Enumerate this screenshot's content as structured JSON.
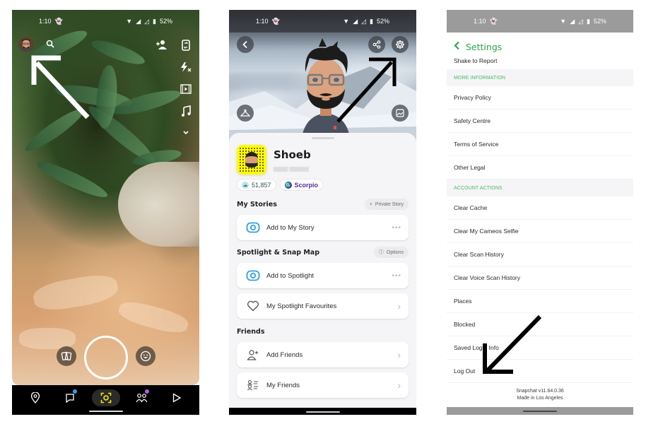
{
  "status_bar": {
    "time": "1:10",
    "battery": "52%"
  },
  "camera": {
    "nav": [
      {
        "name": "map",
        "icon": "map-pin-icon"
      },
      {
        "name": "chat",
        "icon": "chat-icon",
        "badge_color": "#2f9fe8"
      },
      {
        "name": "camera",
        "icon": "camera-scan-icon",
        "active": true,
        "active_color": "#f5e900"
      },
      {
        "name": "stories",
        "icon": "friends-icon",
        "badge_color": "#b25ce8"
      },
      {
        "name": "spotlight",
        "icon": "play-icon"
      }
    ],
    "right_rail": [
      "flip-camera-icon",
      "flash-off-icon",
      "video-filter-icon",
      "music-icon",
      "chevron-down-icon"
    ]
  },
  "profile": {
    "name": "Shoeb",
    "snap_score": "51,857",
    "zodiac": "Scorpio",
    "sections": {
      "my_stories": {
        "title": "My Stories",
        "action": "Private Story",
        "rows": [
          {
            "label": "Add to My Story",
            "trail": "•••"
          }
        ]
      },
      "spotlight": {
        "title": "Spotlight & Snap Map",
        "action": "Options",
        "rows": [
          {
            "label": "Add to Spotlight",
            "trail": "•••"
          },
          {
            "label": "My Spotlight Favourites",
            "trail": "›"
          }
        ]
      },
      "friends": {
        "title": "Friends",
        "rows": [
          {
            "label": "Add Friends",
            "trail": "›"
          },
          {
            "label": "My Friends",
            "trail": "›"
          }
        ]
      }
    },
    "colors": {
      "accent_blue": "#2f9fe8",
      "zodiac_purple": "#5a2aa0",
      "snapcode_yellow": "#fffc00"
    }
  },
  "settings": {
    "title": "Settings",
    "accent": "#2ba84a",
    "first_row": "Shake to Report",
    "more_info_header": "MORE INFORMATION",
    "more_info": [
      "Privacy Policy",
      "Safety Centre",
      "Terms of Service",
      "Other Legal"
    ],
    "account_header": "ACCOUNT ACTIONS",
    "account_actions": [
      "Clear Cache",
      "Clear My Cameos Selfie",
      "Clear Scan History",
      "Clear Voice Scan History",
      "Places",
      "Blocked",
      "Saved Login Info",
      "Log Out"
    ],
    "footer_version": "Snapchat v11.64.0.36",
    "footer_made": "Made in Los Angeles"
  }
}
